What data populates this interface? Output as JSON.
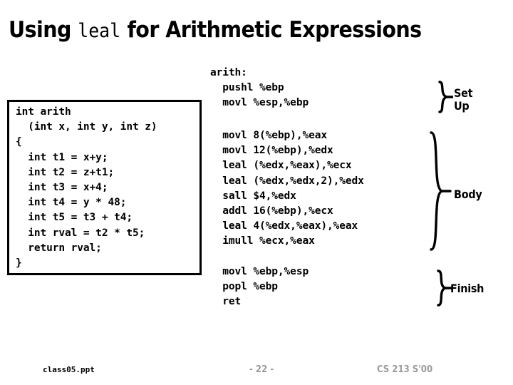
{
  "slide": {
    "title": {
      "before": "Using ",
      "mono": "leal",
      "after": " for Arithmetic Expressions"
    },
    "c_code_box": {
      "code": "int arith\n  (int x, int y, int z)\n{\n  int t1 = x+y;\n  int t2 = z+t1;\n  int t3 = x+4;\n  int t4 = y * 48;\n  int t5 = t3 + t4;\n  int rval = t2 * t5;\n  return rval;\n}"
    },
    "assembly": {
      "setup": {
        "code": "arith:\n  pushl %ebp\n  movl %esp,%ebp",
        "label": "Set\nUp"
      },
      "body": {
        "code": "  movl 8(%ebp),%eax\n  movl 12(%ebp),%edx\n  leal (%edx,%eax),%ecx\n  leal (%edx,%edx,2),%edx\n  sall $4,%edx\n  addl 16(%ebp),%ecx\n  leal 4(%edx,%eax),%eax\n  imull %ecx,%eax",
        "label": "Body"
      },
      "finish": {
        "code": "  movl %ebp,%esp\n  popl %ebp\n  ret",
        "label": "Finish"
      }
    },
    "footer": {
      "file": "class05.ppt",
      "page": "- 22 -",
      "course": "CS 213 S'00"
    },
    "colors": {
      "text": "#000000",
      "footer_gray": "#9a9a9a",
      "background": "#ffffff",
      "box_border": "#000000"
    }
  }
}
